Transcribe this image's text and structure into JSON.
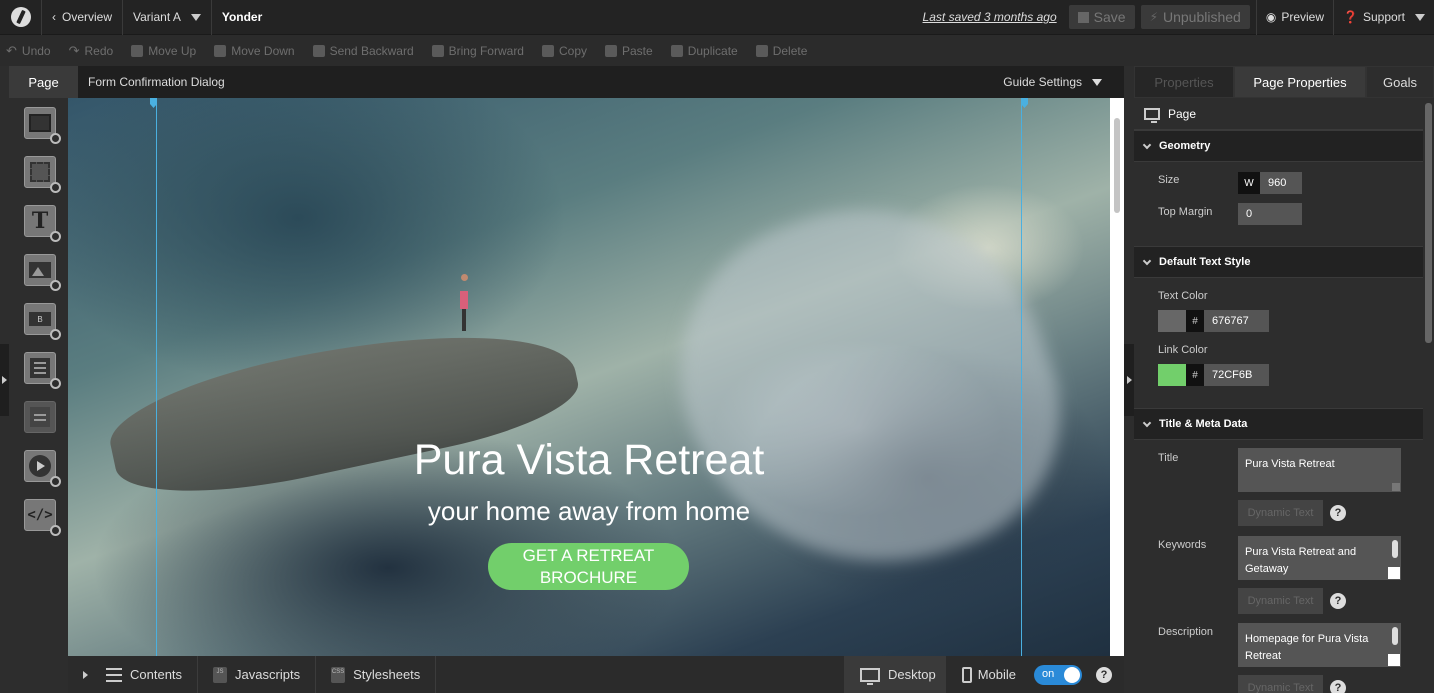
{
  "topbar": {
    "overview": "Overview",
    "variant": "Variant A",
    "page_name": "Yonder",
    "last_saved": "Last saved  3 months ago",
    "save": "Save",
    "unpublished": "Unpublished",
    "preview": "Preview",
    "support": "Support"
  },
  "toolbar": {
    "undo": "Undo",
    "redo": "Redo",
    "move_up": "Move Up",
    "move_down": "Move Down",
    "send_backward": "Send Backward",
    "bring_forward": "Bring Forward",
    "copy": "Copy",
    "paste": "Paste",
    "duplicate": "Duplicate",
    "delete": "Delete"
  },
  "canvas_header": {
    "page_tab": "Page",
    "page_name": "Form Confirmation Dialog",
    "guide_settings": "Guide Settings"
  },
  "stage": {
    "title": "Pura Vista Retreat",
    "subtitle": "your home away from home",
    "button": "GET A RETREAT BROCHURE",
    "button_color": "#72CF6B"
  },
  "bottombar": {
    "contents": "Contents",
    "javascripts": "Javascripts",
    "js_badge": "JS",
    "stylesheets": "Stylesheets",
    "css_badge": "CSS",
    "desktop": "Desktop",
    "mobile": "Mobile",
    "toggle": "on",
    "help": "?"
  },
  "panel": {
    "tabs": [
      "Properties",
      "Page Properties",
      "Goals"
    ],
    "header": "Page",
    "geometry": {
      "title": "Geometry",
      "size_label": "Size",
      "w_label": "W",
      "size_value": "960",
      "top_margin_label": "Top Margin",
      "top_margin_value": "0"
    },
    "text_style": {
      "title": "Default Text Style",
      "text_color_label": "Text Color",
      "text_color_value": "676767",
      "text_color": "#676767",
      "link_color_label": "Link Color",
      "link_color_value": "72CF6B",
      "link_color": "#72CF6B",
      "hash": "#"
    },
    "meta": {
      "title": "Title & Meta Data",
      "title_label": "Title",
      "title_value": "Pura Vista Retreat",
      "keywords_label": "Keywords",
      "keywords_value": "Pura Vista Retreat and Getaway",
      "description_label": "Description",
      "description_value": "Homepage for Pura Vista Retreat",
      "dynamic_text": "Dynamic Text",
      "help": "?"
    }
  }
}
